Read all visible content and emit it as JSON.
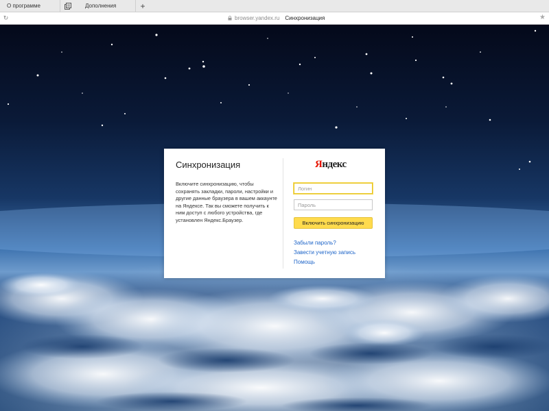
{
  "tabs": [
    {
      "label": "О программе",
      "icon": "none"
    },
    {
      "label": "Дополнения",
      "icon": "addons-icon"
    }
  ],
  "newtab_label": "+",
  "address": {
    "host": "browser.yandex.ru",
    "page_title": "Синхронизация"
  },
  "dialog": {
    "title": "Синхронизация",
    "description": "Включите синхронизацию, чтобы сохранять закладки, пароли, настройки и другие данные браузера в вашем аккаунте на Яндексе. Так вы сможете получить к ним доступ с любого устройства, где установлен Яндекс.Браузер.",
    "logo_first": "Я",
    "logo_rest": "ндекс",
    "login_placeholder": "Логин",
    "password_placeholder": "Пароль",
    "login_value": "",
    "password_value": "",
    "submit_label": "Включить синхронизацию",
    "links": {
      "forgot": "Забыли пароль?",
      "register": "Завести учетную запись",
      "help": "Помощь"
    }
  },
  "colors": {
    "accent_button": "#ffdb4d",
    "link": "#1d64c8",
    "logo_red": "#e61400"
  }
}
